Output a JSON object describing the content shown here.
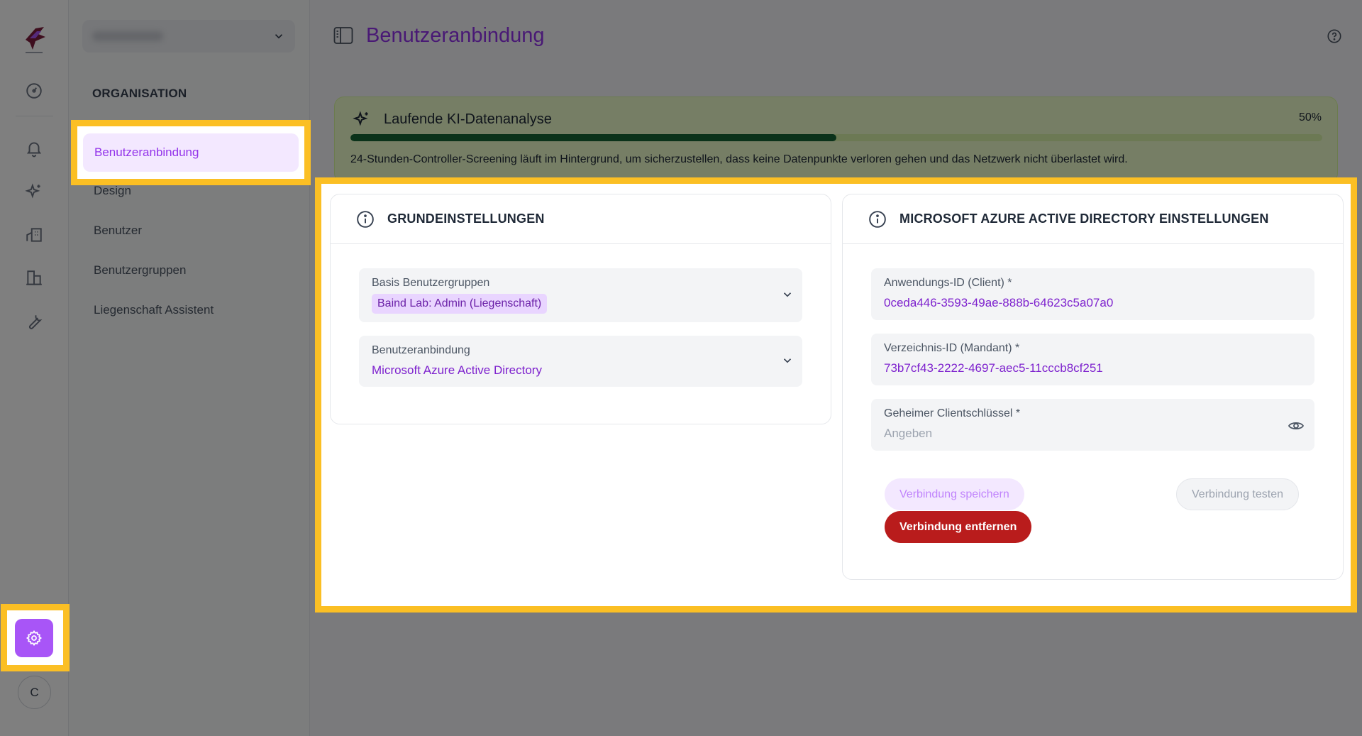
{
  "page": {
    "title": "Benutzeranbindung"
  },
  "sidebar": {
    "section_label": "ORGANISATION",
    "items": [
      {
        "label": "Benutzeranbindung",
        "active": true
      },
      {
        "label": "Design"
      },
      {
        "label": "Benutzer"
      },
      {
        "label": "Benutzergruppen"
      },
      {
        "label": "Liegenschaft Assistent"
      }
    ]
  },
  "rail": {
    "avatar_initial": "C",
    "icons": [
      "dashboard-icon",
      "bell-icon",
      "sparkles-icon",
      "building-icon",
      "buildings-icon",
      "wrench-icon",
      "gear-icon"
    ]
  },
  "ai_banner": {
    "title": "Laufende KI-Datenanalyse",
    "percent_label": "50%",
    "progress": 0.5,
    "description": "24-Stunden-Controller-Screening läuft im Hintergrund, um sicherzustellen, dass keine Datenpunkte verloren gehen und das Netzwerk nicht überlastet wird."
  },
  "basic_settings": {
    "title": "GRUNDEINSTELLUNGEN",
    "groups_label": "Basis Benutzergruppen",
    "groups_chip": "Baind Lab: Admin (Liegenschaft)",
    "binding_label": "Benutzeranbindung",
    "binding_value": "Microsoft Azure Active Directory"
  },
  "azure_settings": {
    "title": "MICROSOFT AZURE ACTIVE DIRECTORY EINSTELLUNGEN",
    "client_id_label": "Anwendungs-ID (Client) *",
    "client_id_value": "0ceda446-3593-49ae-888b-64623c5a07a0",
    "tenant_id_label": "Verzeichnis-ID (Mandant) *",
    "tenant_id_value": "73b7cf43-2222-4697-aec5-11cccb8cf251",
    "secret_label": "Geheimer Clientschlüssel *",
    "secret_placeholder": "Angeben",
    "save_button": "Verbindung speichern",
    "test_button": "Verbindung testen",
    "remove_button": "Verbindung entfernen"
  },
  "colors": {
    "accent": "#9333ea",
    "highlight": "#fbbf24",
    "danger": "#b91c1c",
    "progress": "#166534"
  }
}
